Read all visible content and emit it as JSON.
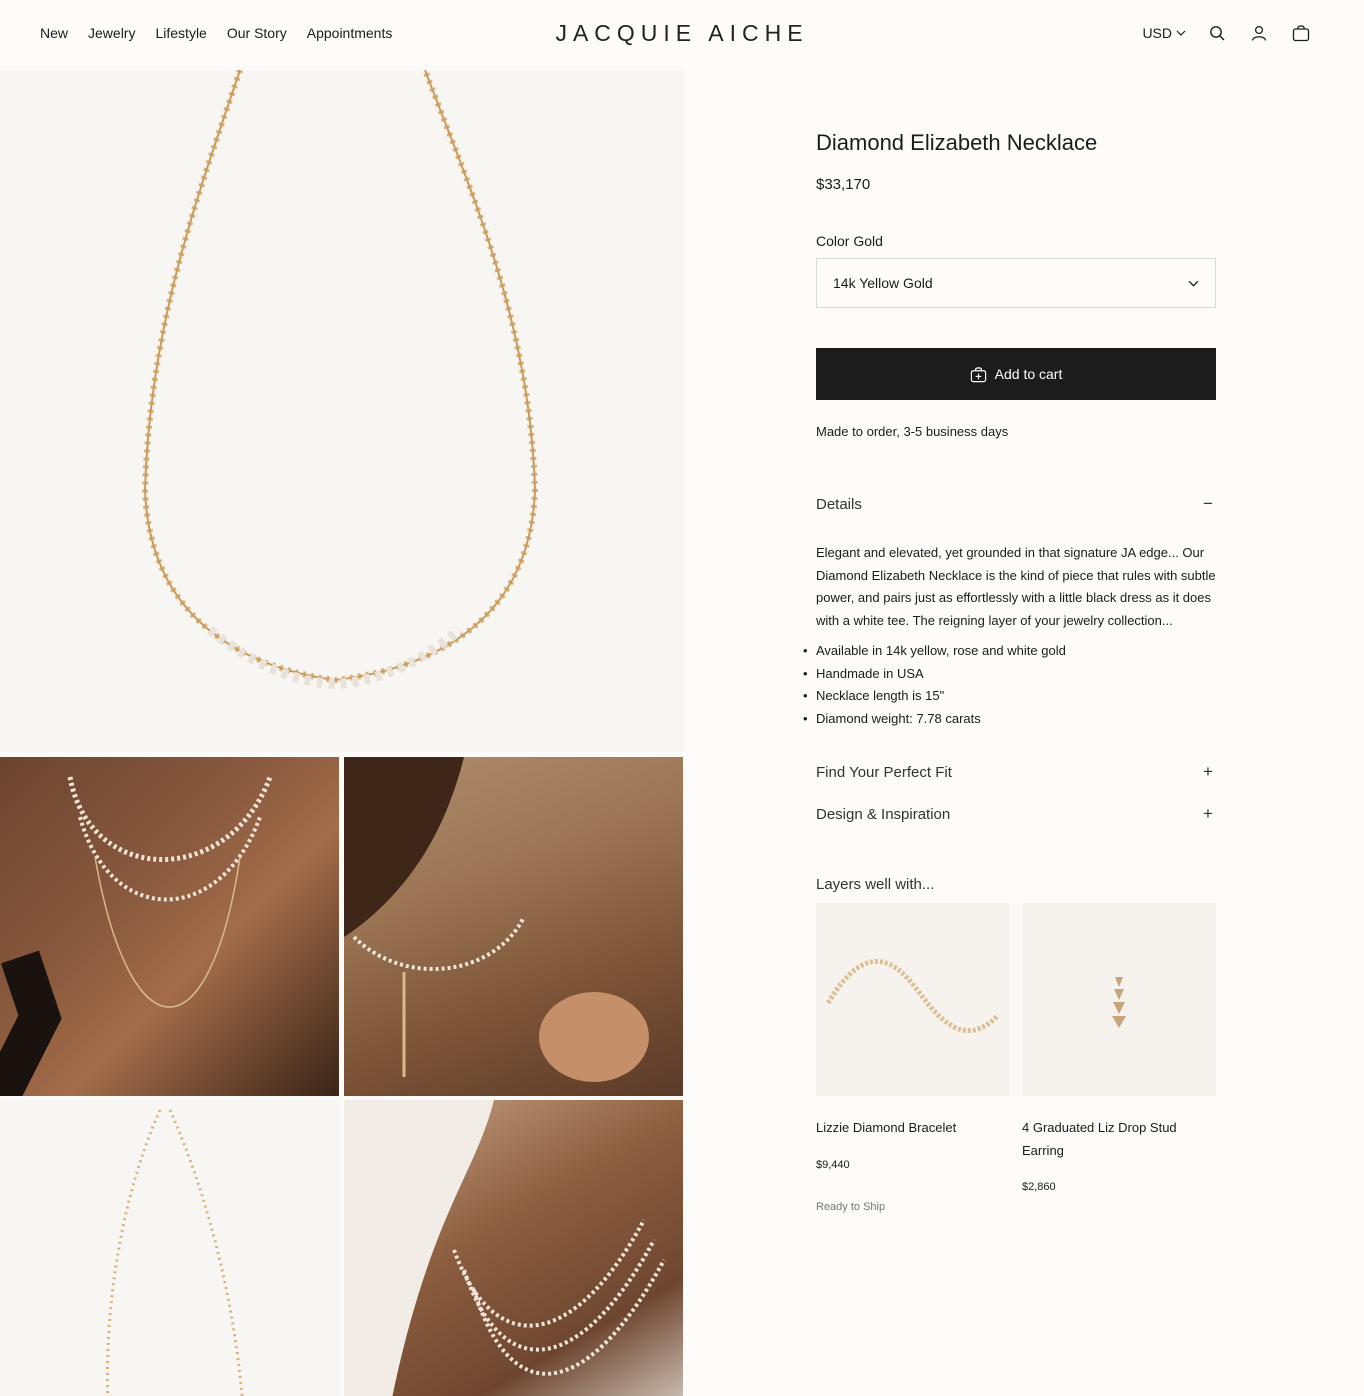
{
  "header": {
    "nav": [
      "New",
      "Jewelry",
      "Lifestyle",
      "Our Story",
      "Appointments"
    ],
    "logo": "JACQUIE AICHE",
    "currency": "USD"
  },
  "product": {
    "title": "Diamond Elizabeth Necklace",
    "price": "$33,170",
    "color_label": "Color Gold",
    "selected_color": "14k Yellow Gold",
    "add_to_cart": "Add to cart",
    "made_to_order": "Made to order, 3-5 business days"
  },
  "details": {
    "title": "Details",
    "toggle": "−",
    "description": "Elegant and elevated, yet grounded in that signature JA edge... Our Diamond Elizabeth Necklace is the kind of piece that rules with subtle power, and pairs just as effortlessly with a little black dress as it does with a white tee. The reigning layer of your jewelry collection...",
    "bullets": [
      "Available in 14k yellow, rose and white gold",
      "Handmade in USA",
      "Necklace length is 15\"",
      "Diamond weight: 7.78 carats"
    ]
  },
  "accordions": [
    {
      "title": "Find Your Perfect Fit",
      "toggle": "+"
    },
    {
      "title": "Design & Inspiration",
      "toggle": "+"
    }
  ],
  "layers": {
    "title": "Layers well with...",
    "items": [
      {
        "name": "Lizzie Diamond Bracelet",
        "price": "$9,440",
        "status": "Ready to Ship"
      },
      {
        "name": "4 Graduated Liz Drop Stud Earring",
        "price": "$2,860",
        "status": ""
      }
    ]
  },
  "icons": {
    "search": "search-icon",
    "account": "user-icon",
    "cart": "bag-icon",
    "dropdown": "chevron-down-icon"
  },
  "colors": {
    "background": "#fcfbfa",
    "button": "#1c1c1c",
    "gold": "#c99a5b"
  }
}
